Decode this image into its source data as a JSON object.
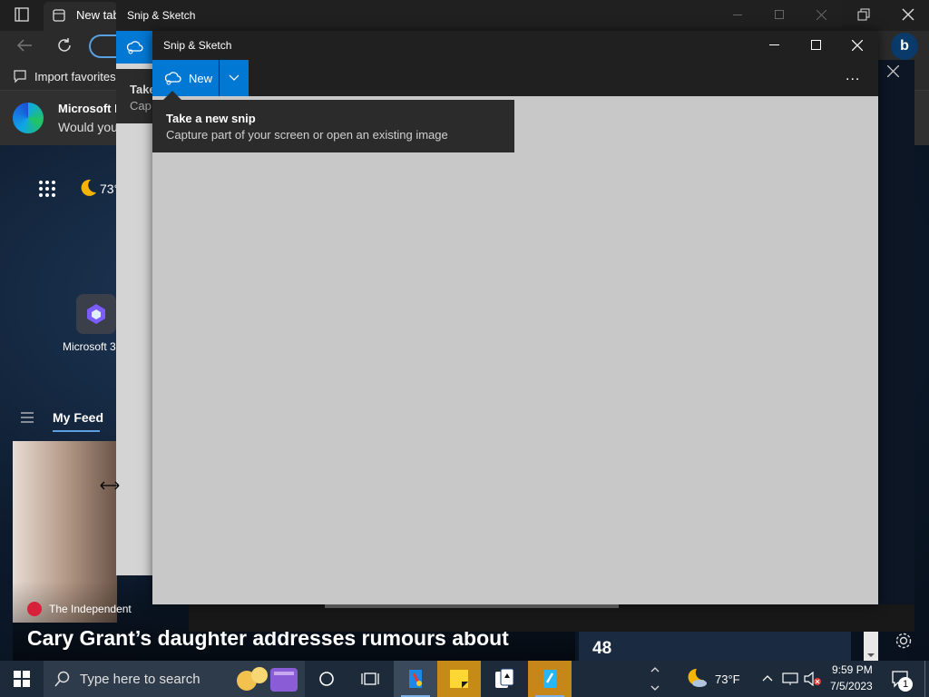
{
  "browser": {
    "tab_title": "New tab",
    "favorites_bar": {
      "import_label": "Import favorites"
    },
    "infobar": {
      "title": "Microsoft E",
      "message": "Would you"
    },
    "weather": "73°",
    "app_tile_label": "Microsoft 3",
    "feed_tab": "My Feed",
    "news": {
      "source": "The Independent",
      "headline": "Cary Grant’s daughter addresses rumours about",
      "side_number": "48"
    }
  },
  "snip_back_window": {
    "title": "Snip & Sketch",
    "tip_title_partial": "Take",
    "tip_text_partial": "Cap"
  },
  "snip_window": {
    "title": "Snip & Sketch",
    "new_button": "New",
    "more_options": "...",
    "tooltip": {
      "title": "Take a new snip",
      "description": "Capture part of your screen or open an existing image"
    }
  },
  "taskbar": {
    "search_placeholder": "Type here to search",
    "weather_temp": "73°F",
    "time": "9:59 PM",
    "date": "7/5/2023",
    "notification_count": "1"
  },
  "colors": {
    "accent": "#0078d4",
    "title_bar": "#202020",
    "canvas": "#c8c8c8",
    "taskbar": "#1c2a3a"
  }
}
